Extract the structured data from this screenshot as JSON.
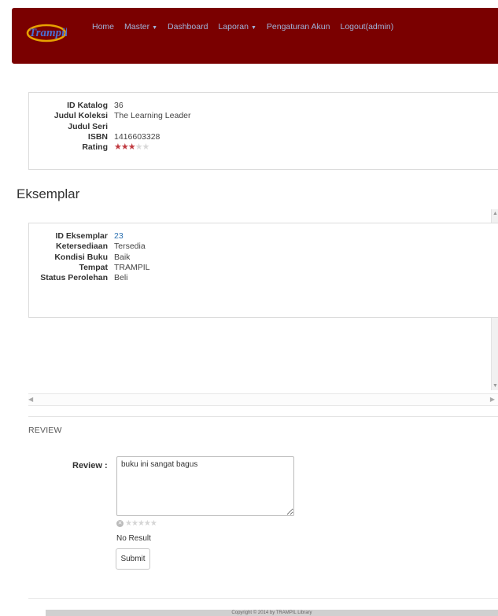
{
  "navbar": {
    "brand": "Trampil",
    "items": [
      {
        "label": "Home",
        "dropdown": false
      },
      {
        "label": "Master",
        "dropdown": true
      },
      {
        "label": "Dashboard",
        "dropdown": false
      },
      {
        "label": "Laporan",
        "dropdown": true
      },
      {
        "label": "Pengaturan Akun",
        "dropdown": false
      },
      {
        "label": "Logout(admin)",
        "dropdown": false
      }
    ],
    "colors": {
      "background": "#7a0000",
      "link": "#9fb3d9"
    }
  },
  "catalog": {
    "fields": [
      {
        "label": "ID Katalog",
        "value": "36"
      },
      {
        "label": "Judul Koleksi",
        "value": "The Learning Leader"
      },
      {
        "label": "Judul Seri",
        "value": ""
      },
      {
        "label": "ISBN",
        "value": "1416603328"
      },
      {
        "label": "Rating",
        "value": ""
      }
    ],
    "rating": {
      "value": 3,
      "max": 5,
      "color": "#c0393f"
    }
  },
  "eksemplar": {
    "heading": "Eksemplar",
    "fields": [
      {
        "label": "ID Eksemplar",
        "value": "23"
      },
      {
        "label": "Ketersediaan",
        "value": "Tersedia"
      },
      {
        "label": "Kondisi Buku",
        "value": "Baik"
      },
      {
        "label": "Tempat",
        "value": "TRAMPIL"
      },
      {
        "label": "Status Perolehan",
        "value": "Beli"
      }
    ]
  },
  "review": {
    "heading": "REVIEW",
    "label": "Review :",
    "text": "buku ini sangat bagus",
    "rating_value": 0,
    "rating_max": 5,
    "result_text": "No Result",
    "submit_label": "Submit"
  },
  "footer": {
    "copyright": "Copyright © 2014 by TRAMPIL Library"
  }
}
